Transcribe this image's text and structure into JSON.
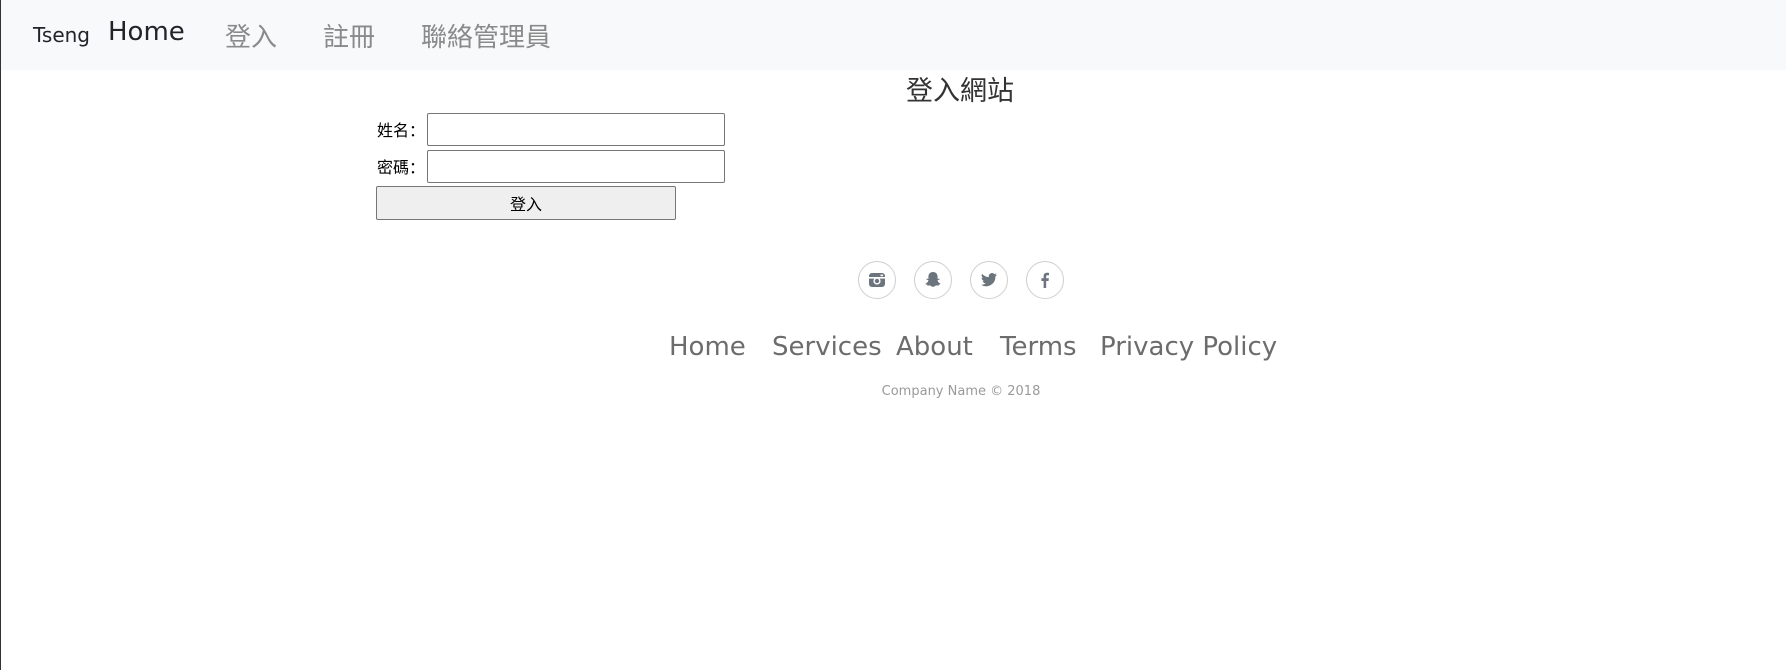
{
  "nav": {
    "brand": "Tseng",
    "home": "Home",
    "login": "登入",
    "register": "註冊",
    "contact_admin": "聯絡管理員"
  },
  "main": {
    "title": "登入網站"
  },
  "form": {
    "name_label": "姓名：",
    "password_label": "密碼：",
    "name_value": "",
    "password_value": "",
    "submit_label": "登入"
  },
  "social": {
    "icons": [
      "instagram-icon",
      "snapchat-icon",
      "twitter-icon",
      "facebook-icon"
    ],
    "icon_color": "#6c757d",
    "border_color": "#cfcfcf"
  },
  "footer": {
    "links": [
      "Home",
      "Services",
      "About",
      "Terms",
      "Privacy Policy"
    ],
    "copyright": "Company Name © 2018"
  },
  "colors": {
    "navbar_bg": "#f8f9fa",
    "nav_active": "#212529",
    "nav_inactive": "#8a8a8a",
    "button_bg": "#efefef"
  }
}
